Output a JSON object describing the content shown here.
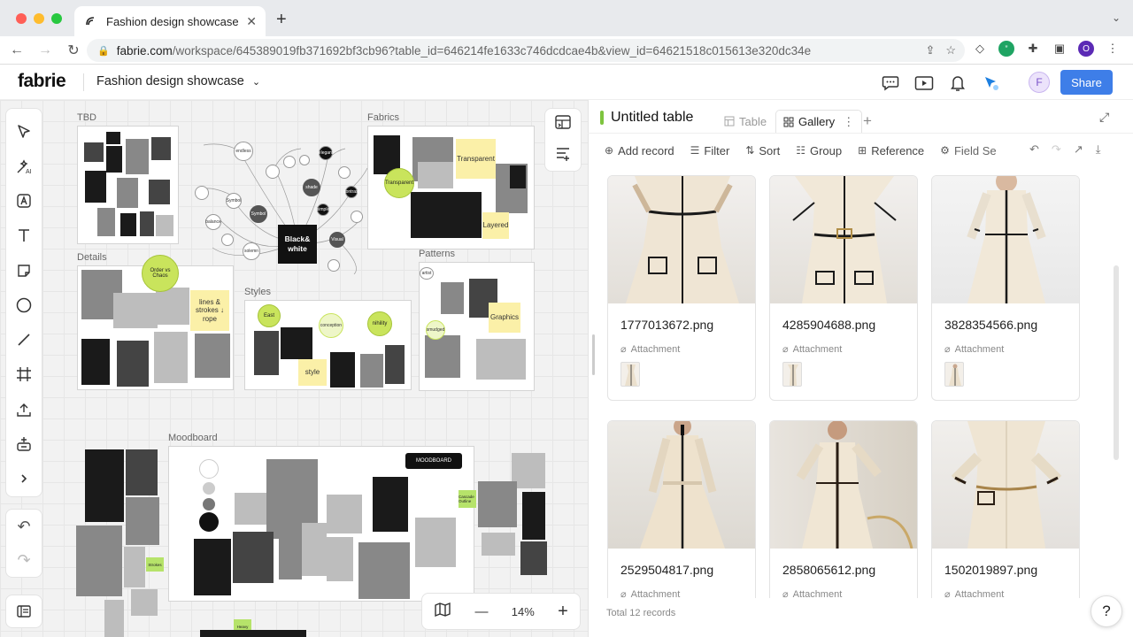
{
  "browser": {
    "tab_title": "Fashion design showcase",
    "url_host": "fabrie.com",
    "url_path": "/workspace/645389019fb371692bf3cb96?table_id=646214fe1633c746dcdcae4b&view_id=64621518c015613e320dc34e",
    "profile_initial": "O"
  },
  "app": {
    "logo": "fabrie",
    "workspace_name": "Fashion design showcase",
    "user_initial": "F",
    "share_label": "Share"
  },
  "canvas": {
    "frames": {
      "tbd": "TBD",
      "fabrics": "Fabrics",
      "details": "Details",
      "styles": "Styles",
      "patterns": "Patterns",
      "moodboard": "Moodboard"
    },
    "mindmap": {
      "center": "Black& white",
      "nodes": [
        "endless",
        "Symbol",
        "Visual",
        "solemn",
        "shade",
        "elegant",
        "simple",
        "contrast",
        "Symbol",
        "balance"
      ]
    },
    "stickies": {
      "transparent": "Transparent",
      "layered": "Layered",
      "lines": "lines & strokes ↓ rope",
      "graphics": "Graphics",
      "style": "style"
    },
    "green_nodes": {
      "order_vs_chaos": "Order vs Chaos",
      "transparent": "Transparent",
      "east": "East",
      "conception": "conception",
      "nihility": "nihility",
      "smudged": "smudged",
      "artist": "artist"
    },
    "moodboard_pill": "MOODBOARD",
    "tags": {
      "strokes": "Strokes",
      "cascade": "Cascade Outline",
      "heavy": "Heavy"
    },
    "zoom": "14%"
  },
  "panel": {
    "title": "Untitled table",
    "views": {
      "table": "Table",
      "gallery": "Gallery"
    },
    "actions": {
      "add_record": "Add record",
      "filter": "Filter",
      "sort": "Sort",
      "group": "Group",
      "reference": "Reference",
      "field_settings": "Field Se"
    },
    "field_label": "Attachment",
    "cards": [
      {
        "name": "1777013672.png"
      },
      {
        "name": "4285904688.png"
      },
      {
        "name": "3828354566.png"
      },
      {
        "name": "2529504817.png"
      },
      {
        "name": "2858065612.png"
      },
      {
        "name": "1502019897.png"
      }
    ],
    "total": "Total 12 records"
  }
}
